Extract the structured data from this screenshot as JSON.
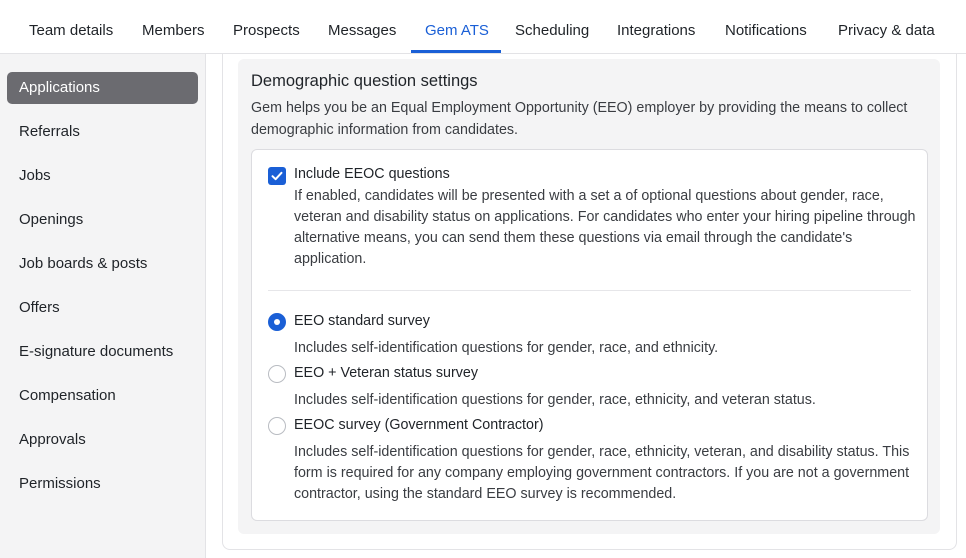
{
  "topnav": {
    "tabs": [
      {
        "label": "Team details"
      },
      {
        "label": "Members"
      },
      {
        "label": "Prospects"
      },
      {
        "label": "Messages"
      },
      {
        "label": "Gem ATS"
      },
      {
        "label": "Scheduling"
      },
      {
        "label": "Integrations"
      },
      {
        "label": "Notifications"
      },
      {
        "label": "Privacy & data"
      }
    ],
    "active_tab": "Gem ATS"
  },
  "sidebar": {
    "items": [
      {
        "label": "Applications"
      },
      {
        "label": "Referrals"
      },
      {
        "label": "Jobs"
      },
      {
        "label": "Openings"
      },
      {
        "label": "Job boards & posts"
      },
      {
        "label": "Offers"
      },
      {
        "label": "E-signature documents"
      },
      {
        "label": "Compensation"
      },
      {
        "label": "Approvals"
      },
      {
        "label": "Permissions"
      }
    ],
    "active_item": "Applications"
  },
  "section": {
    "title": "Demographic question settings",
    "description": "Gem helps you be an Equal Employment Opportunity (EEO) employer by providing the means to collect demographic information from candidates."
  },
  "eeoc_toggle": {
    "label": "Include EEOC questions",
    "checked": true,
    "description": "If enabled, candidates will be presented with a set a of optional questions about gender, race, veteran and disability status on applications. For candidates who enter your hiring pipeline through alternative means, you can send them these questions via email through the candidate's application."
  },
  "survey_options": [
    {
      "label": "EEO standard survey",
      "description": "Includes self-identification questions for gender, race, and ethnicity.",
      "selected": true
    },
    {
      "label": "EEO + Veteran status survey",
      "description": "Includes self-identification questions for gender, race, ethnicity, and veteran status.",
      "selected": false
    },
    {
      "label": "EEOC survey (Government Contractor)",
      "description": "Includes self-identification questions for gender, race, ethnicity, veteran, and disability status. This form is required for any company employing government contractors. If you are not a government contractor, using the standard EEO survey is recommended.",
      "selected": false
    }
  ],
  "colors": {
    "accent": "#1a5fd6",
    "sidebar_active_bg": "#6b6b70",
    "sidebar_bg": "#f4f4f5"
  },
  "icons": {
    "checkbox_mark": "checkmark-icon"
  }
}
